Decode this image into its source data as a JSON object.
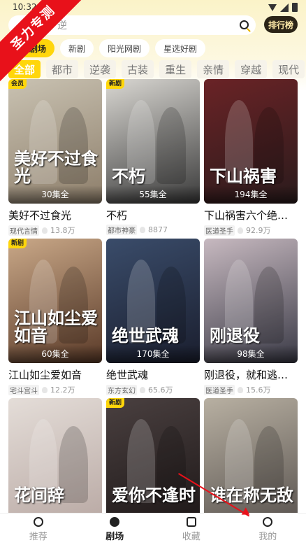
{
  "status": {
    "time": "10:32"
  },
  "watermark": {
    "text": "圣力专测"
  },
  "search": {
    "placeholder": "逆",
    "rank_label": "排行榜"
  },
  "chips": [
    {
      "label": "剧场"
    },
    {
      "label": "新剧"
    },
    {
      "label": "阳光网剧"
    },
    {
      "label": "星选好剧"
    }
  ],
  "categories": [
    "全部",
    "都市",
    "逆袭",
    "古装",
    "重生",
    "亲情",
    "穿越",
    "现代"
  ],
  "cards": [
    {
      "badge": "会员",
      "art_text": "美好不过食光",
      "episodes": "30集全",
      "title": "美好不过食光",
      "tag": "现代言情",
      "heat": "13.8万",
      "colors": [
        "#c9c2b2",
        "#8d7e6a"
      ]
    },
    {
      "badge": "新剧",
      "art_text": "不朽",
      "episodes": "55集全",
      "title": "不朽",
      "tag": "都市神豪",
      "heat": "8877",
      "colors": [
        "#d9d7d2",
        "#3a3a3a"
      ]
    },
    {
      "badge": "",
      "art_text": "下山祸害",
      "episodes": "194集全",
      "title": "下山祸害六个绝…",
      "tag": "医道圣手",
      "heat": "92.9万",
      "colors": [
        "#6a2326",
        "#2a1b1c"
      ]
    },
    {
      "badge": "新剧",
      "art_text": "江山如尘爱如音",
      "episodes": "60集全",
      "title": "江山如尘爱如音",
      "tag": "宅斗宫斗",
      "heat": "12.2万",
      "colors": [
        "#c9a888",
        "#5a3a28"
      ]
    },
    {
      "badge": "",
      "art_text": "绝世武魂",
      "episodes": "170集全",
      "title": "绝世武魂",
      "tag": "东方玄幻",
      "heat": "65.6万",
      "colors": [
        "#3a4c6a",
        "#1a1e2e"
      ]
    },
    {
      "badge": "",
      "art_text": "刚退役",
      "episodes": "98集全",
      "title": "刚退役，就和逃…",
      "tag": "医道圣手",
      "heat": "15.6万",
      "colors": [
        "#c7b9c0",
        "#3a3a46"
      ]
    },
    {
      "badge": "",
      "art_text": "花间辞",
      "episodes": "",
      "title": "",
      "tag": "",
      "heat": "",
      "colors": [
        "#e4ddd8",
        "#b9a9a4"
      ]
    },
    {
      "badge": "新剧",
      "art_text": "爱你不逢时",
      "episodes": "",
      "title": "",
      "tag": "",
      "heat": "",
      "colors": [
        "#4a4040",
        "#1e1818"
      ]
    },
    {
      "badge": "",
      "art_text": "谁在称无敌",
      "episodes": "",
      "title": "",
      "tag": "",
      "heat": "",
      "colors": [
        "#b8b0a2",
        "#5a5450"
      ]
    }
  ],
  "nav": [
    {
      "label": "推荐"
    },
    {
      "label": "剧场"
    },
    {
      "label": "收藏"
    },
    {
      "label": "我的"
    }
  ]
}
